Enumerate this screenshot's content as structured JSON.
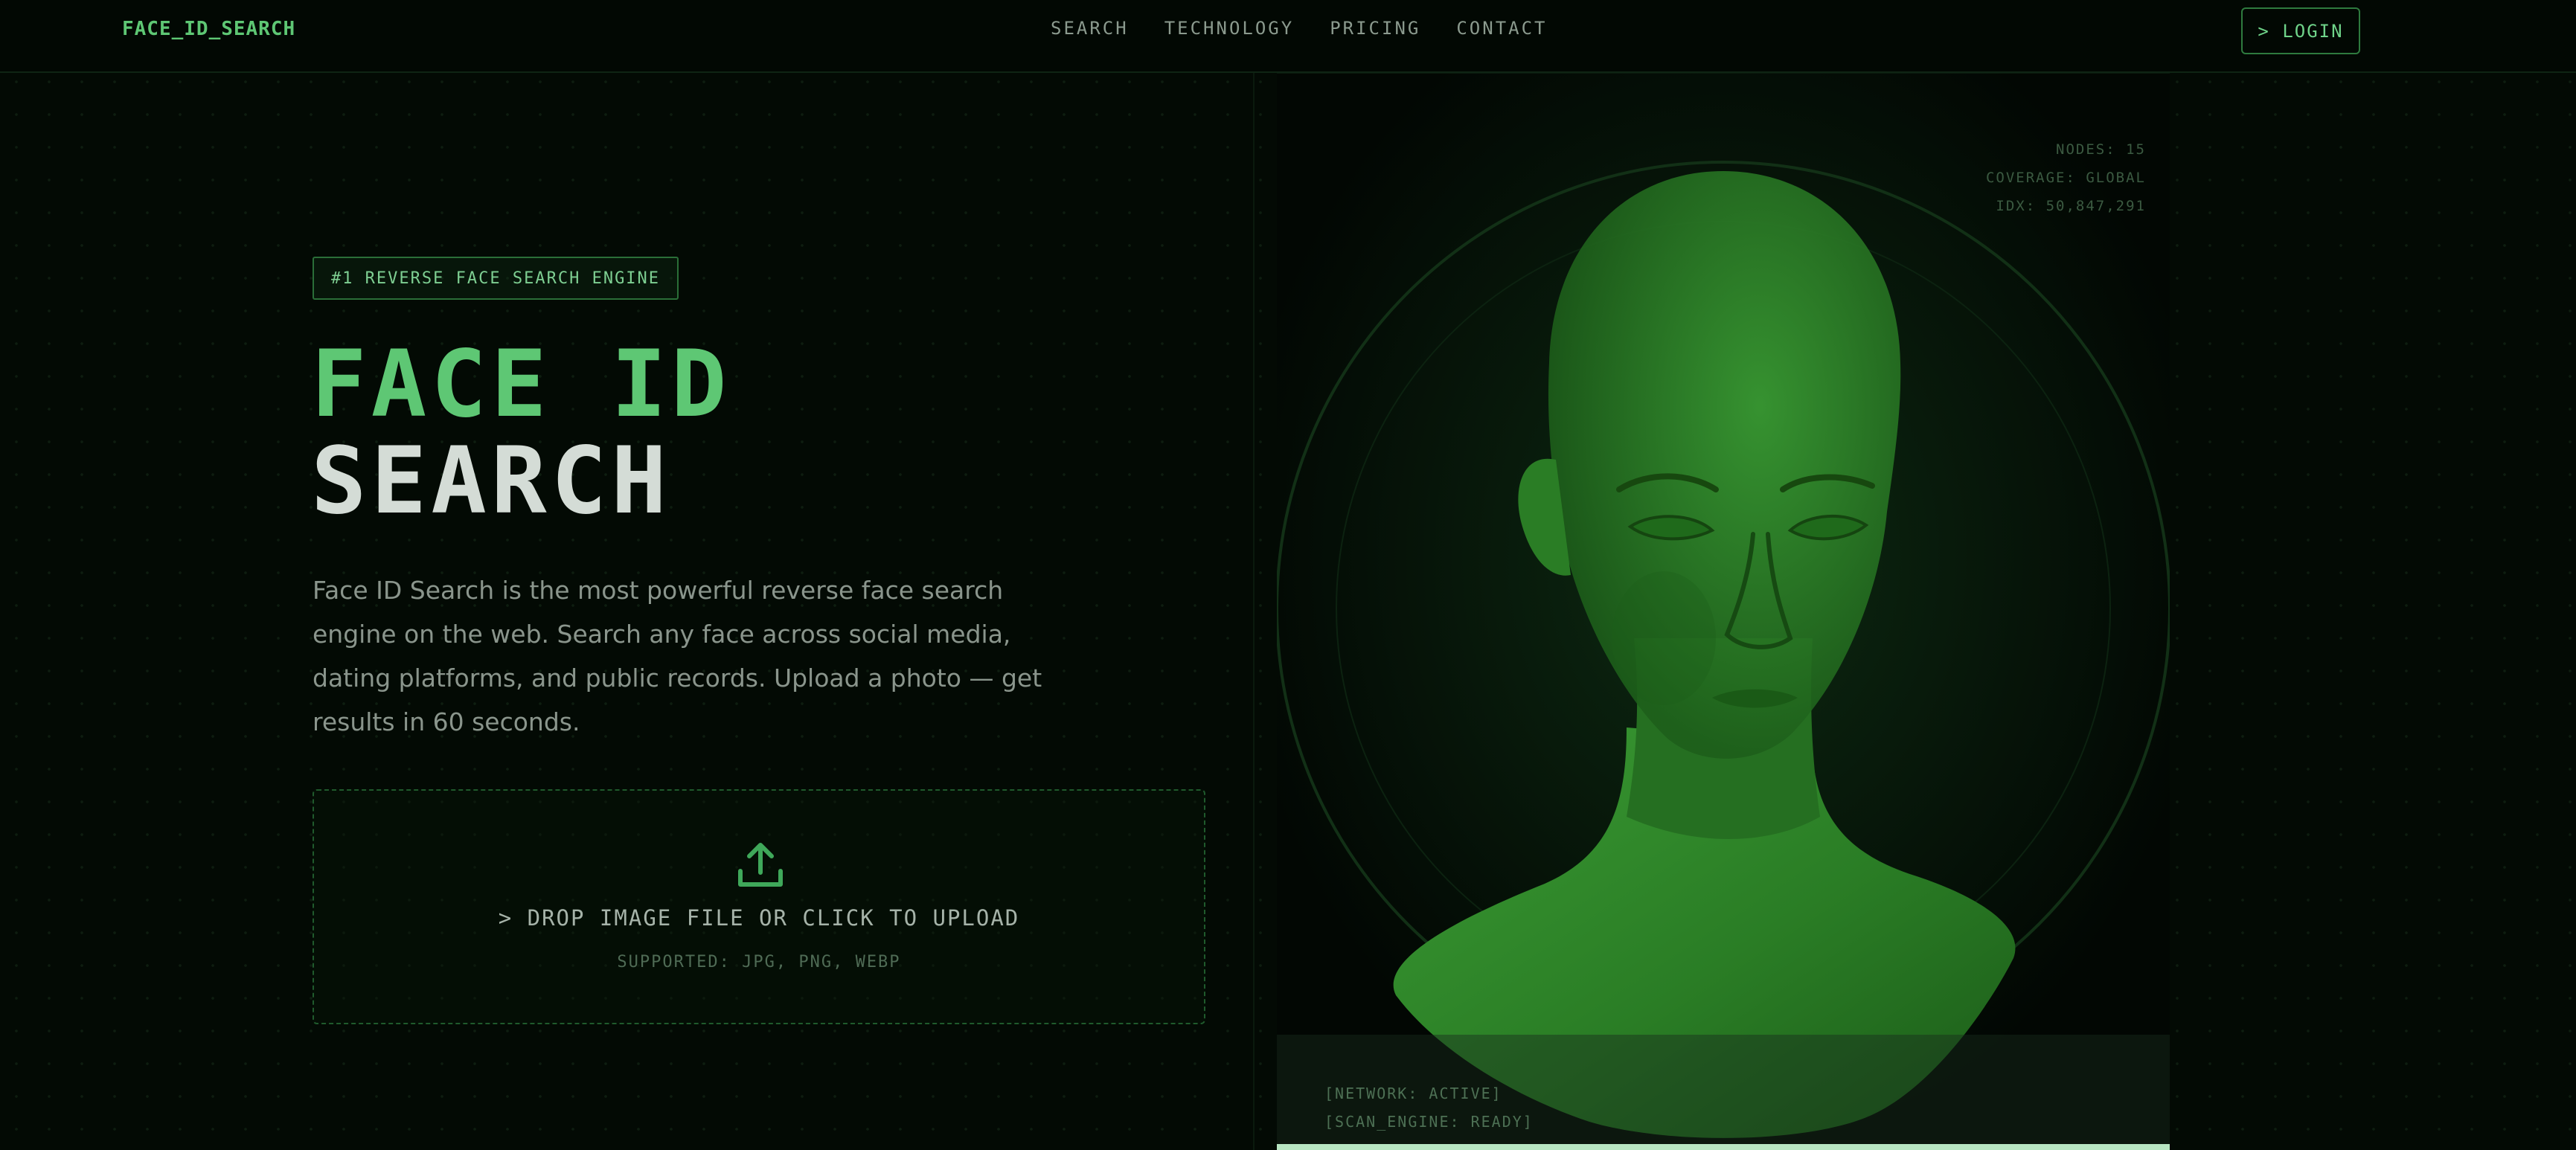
{
  "header": {
    "logo": "FACE_ID_SEARCH",
    "nav": [
      {
        "label": "SEARCH"
      },
      {
        "label": "TECHNOLOGY"
      },
      {
        "label": "PRICING"
      },
      {
        "label": "CONTACT"
      }
    ],
    "login_label": "> LOGIN"
  },
  "hero": {
    "badge": "#1 REVERSE FACE SEARCH ENGINE",
    "title_line1": "FACE ID",
    "title_line2": "SEARCH",
    "description": "Face ID Search is the most powerful reverse face search engine on the web. Search any face across social media, dating platforms, and public records. Upload a photo — get results in 60 seconds."
  },
  "upload": {
    "icon": "upload-icon",
    "title": "> DROP IMAGE FILE OR CLICK TO UPLOAD",
    "supported": "SUPPORTED: JPG, PNG, WEBP"
  },
  "visual": {
    "hud": {
      "nodes": "NODES: 15",
      "coverage": "COVERAGE: GLOBAL",
      "idx": "IDX: 50,847,291"
    },
    "status": {
      "network": "[NETWORK: ACTIVE]",
      "scan_engine": "[SCAN_ENGINE: READY]"
    }
  },
  "colors": {
    "accent": "#5ec774",
    "background": "#030a04",
    "text_muted": "#8a958c",
    "head_green": "#2f8a2a"
  }
}
